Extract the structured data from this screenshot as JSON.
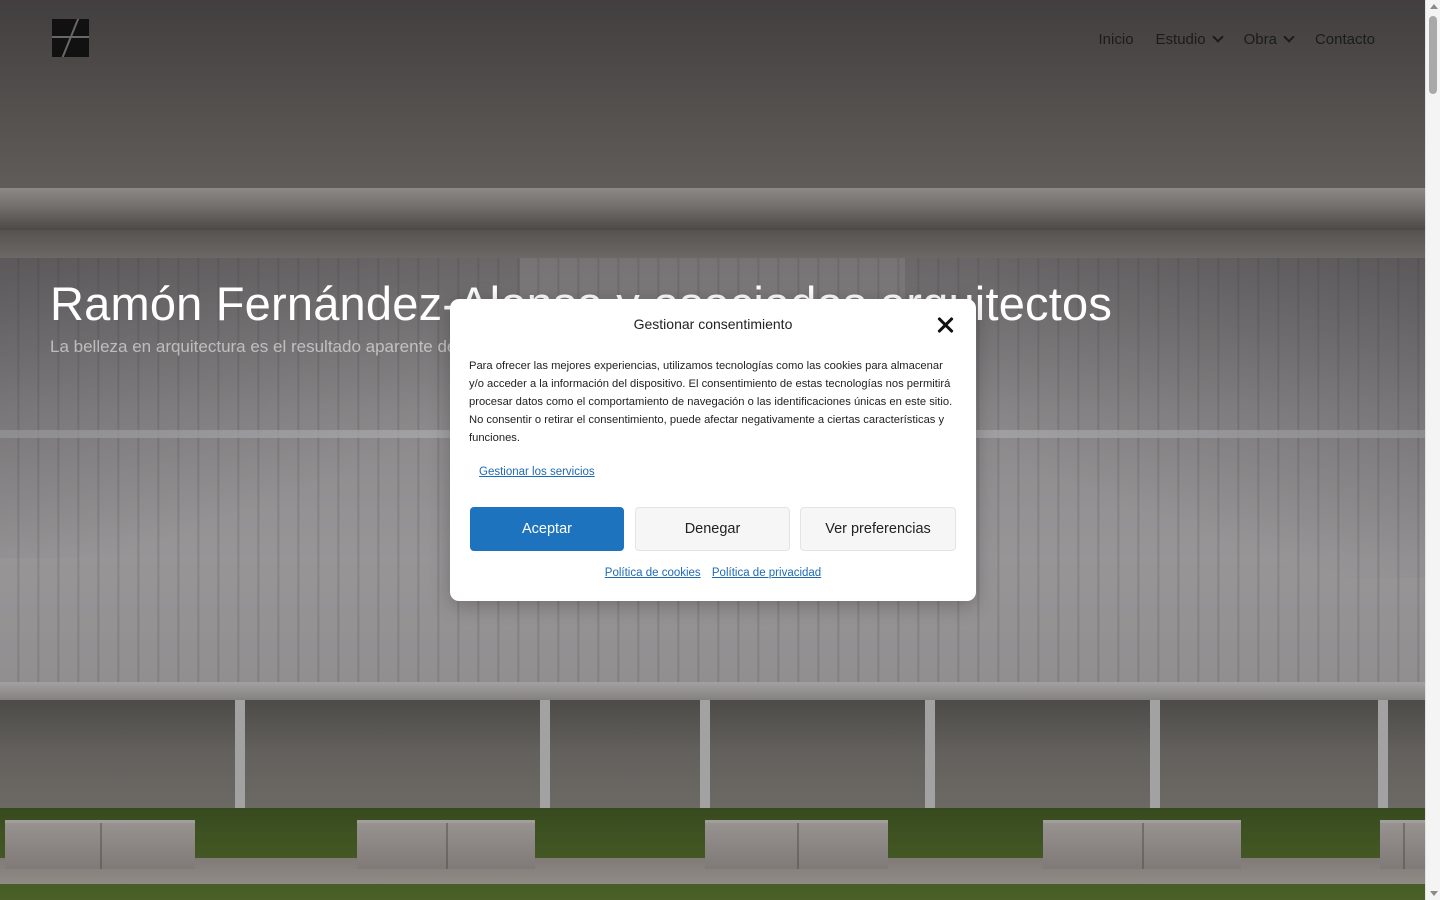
{
  "header": {
    "nav": [
      {
        "label": "Inicio",
        "has_dropdown": false
      },
      {
        "label": "Estudio",
        "has_dropdown": true
      },
      {
        "label": "Obra",
        "has_dropdown": true
      },
      {
        "label": "Contacto",
        "has_dropdown": false
      }
    ]
  },
  "hero": {
    "title": "Ramón Fernández-Alonso y asociados arquitectos",
    "subtitle": "La belleza en arquitectura es el resultado aparente de una"
  },
  "consent": {
    "title": "Gestionar consentimiento",
    "body": "Para ofrecer las mejores experiencias, utilizamos tecnologías como las cookies para almacenar y/o acceder a la información del dispositivo.  El consentimiento de estas tecnologías nos permitirá procesar datos como el comportamiento de navegación o las identificaciones únicas en este sitio.  No consentir o retirar el consentimiento, puede afectar negativamente a ciertas características y funciones.",
    "manage_link": "Gestionar los servicios",
    "buttons": {
      "accept": "Aceptar",
      "deny": "Denegar",
      "preferences": "Ver preferencias"
    },
    "links": {
      "cookies": "Política de cookies",
      "privacy": "Política de privacidad"
    }
  },
  "colors": {
    "accept": "#1e73be",
    "link": "#1e6ab4"
  }
}
